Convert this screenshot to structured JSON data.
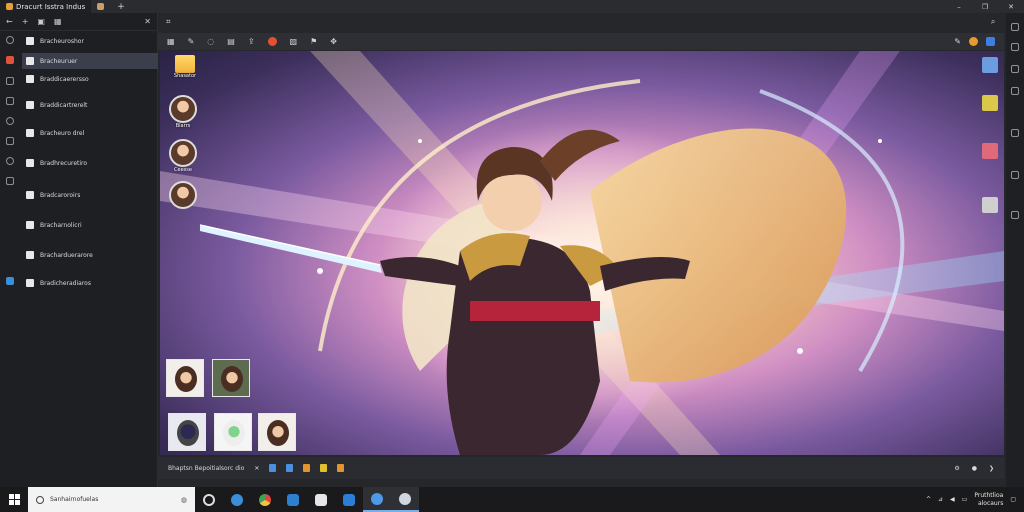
{
  "window": {
    "tabs": [
      {
        "label": "Dracurt Isstra Indus"
      },
      {
        "label": ""
      }
    ],
    "new_tab": "+",
    "controls": [
      "–",
      "❐",
      "✕"
    ]
  },
  "sidebar": {
    "nav": [
      "←",
      "+",
      "▣",
      "▦"
    ],
    "close": "✕",
    "items": [
      {
        "label": "Bracheuroshor"
      },
      {
        "label": "Bracheuruer"
      },
      {
        "label": "Braddicaerersso"
      },
      {
        "label": "Braddicartrerelt"
      },
      {
        "label": "Bracheuro drel"
      },
      {
        "label": "Bradhrecuretiro"
      },
      {
        "label": "Bradcaroroirs"
      },
      {
        "label": "Bracharnolicri"
      },
      {
        "label": "Bracharduerarore"
      },
      {
        "label": "Bradicheradiaros"
      }
    ]
  },
  "toolbar": {
    "left": "⌗",
    "right": [
      "⌕",
      "✕"
    ]
  },
  "desktop": {
    "icons": [
      {
        "label": "Shasator"
      },
      {
        "label": "Blarrs"
      },
      {
        "label": "Ceesse"
      },
      {
        "label": ""
      }
    ]
  },
  "statusbar": {
    "left": "Bhaptsn   Bepoitialsorc dio",
    "icons": [
      "✕",
      "■",
      "■",
      "■",
      "■",
      "■"
    ]
  },
  "taskbar": {
    "search_placeholder": "Sanhairnofuelas",
    "tray_time": "Pruthtlioa",
    "tray_date": "alocaurs"
  },
  "colors": {
    "accent": "#3a8fd8",
    "tab_favicon": "#e2a33b"
  }
}
